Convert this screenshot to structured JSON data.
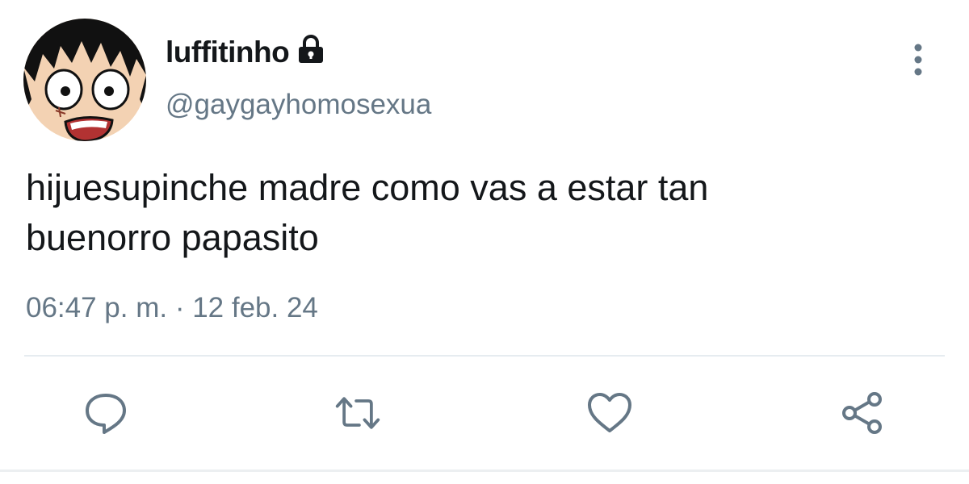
{
  "user": {
    "display_name": "luffitinho",
    "handle": "@gaygayhomosexua",
    "protected": true,
    "avatar": "anime-character-avatar"
  },
  "tweet": {
    "text_line1": "hijuesupinche madre como vas a estar tan",
    "text_line2": "buenorro papasito",
    "timestamp": "06:47 p. m. · 12 feb. 24"
  },
  "icons": {
    "lock": "lock-icon",
    "more": "more-vertical-icon",
    "reply": "reply-icon",
    "retweet": "retweet-icon",
    "like": "heart-icon",
    "share": "share-icon"
  },
  "colors": {
    "text_primary": "#14171a",
    "text_secondary": "#657786",
    "divider": "#e6ecf0"
  }
}
